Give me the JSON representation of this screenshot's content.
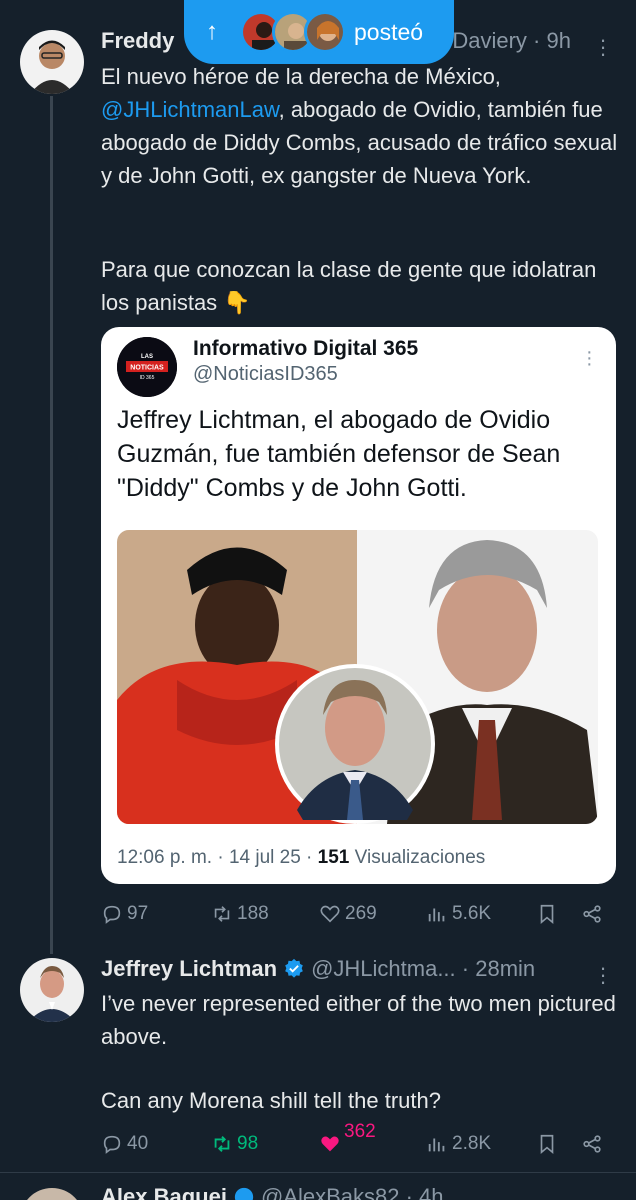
{
  "banner": {
    "arrow": "↑",
    "label": "posteó"
  },
  "post1": {
    "name": "Freddy",
    "handle": "Daviery",
    "time": "9h",
    "mention": "@JHLichtmanLaw",
    "text_a": "El nuevo héroe de la derecha de México, ",
    "text_b": ", abogado de Ovidio, también fue abogado de Diddy Combs, acusado de tráfico sexual y de John Gotti, ex gangster de Nueva York.",
    "text_c": "Para que conozcan la clase de gente que idolatran los panistas 👇",
    "quote": {
      "avatar_text_1": "LAS",
      "avatar_text_2": "NOTICIAS",
      "avatar_text_3": "ID 365",
      "name": "Informativo Digital 365",
      "handle": "@NoticiasID365",
      "text": "Jeffrey Lichtman, el abogado de Ovidio Guzmán, fue también defensor de Sean \"Diddy\" Combs y de John Gotti.",
      "meta_time": "12:06 p. m. · 14 jul 25 · ",
      "views_count": "151",
      "views_label": " Visualizaciones"
    },
    "stats": {
      "replies": "97",
      "reposts": "188",
      "likes": "269",
      "views": "5.6K"
    }
  },
  "post2": {
    "name": "Jeffrey Lichtman",
    "handle": "@JHLichtma...",
    "time": "28min",
    "text_a": "I’ve never represented either of the two men pictured above.",
    "text_b": "Can any Morena shill tell the truth?",
    "stats": {
      "replies": "40",
      "reposts": "98",
      "likes": "362",
      "views": "2.8K"
    }
  },
  "post3": {
    "name": "Alex Baquei",
    "handle": "@AlexBaks82",
    "time": "4h"
  },
  "colors": {
    "accent": "#1d9bf0",
    "repost_active": "#00ba7c",
    "like_active": "#f91880",
    "background": "#15202b"
  }
}
